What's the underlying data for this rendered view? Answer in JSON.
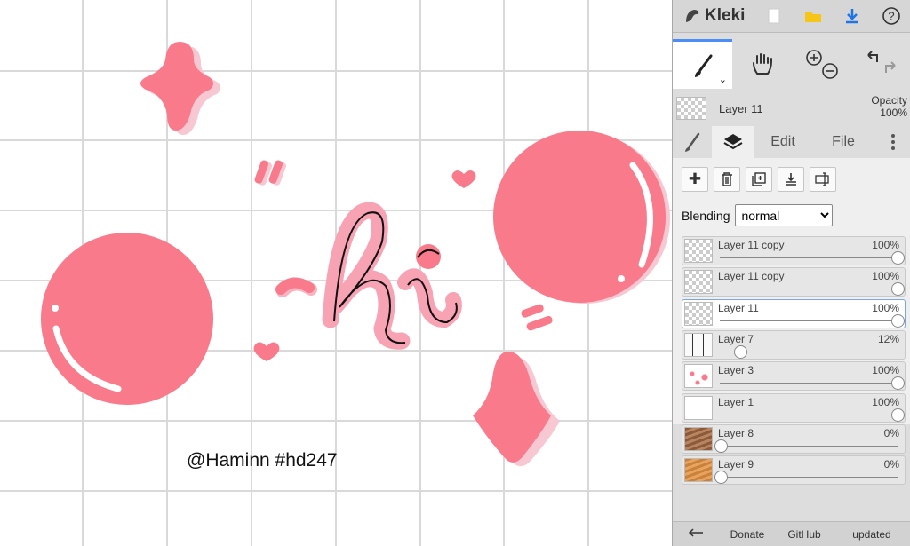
{
  "app": {
    "name": "Kleki"
  },
  "canvas": {
    "watermark": "@Haminn #hd247",
    "drawing_text": "hi"
  },
  "current_layer": {
    "name": "Layer 11",
    "opacity_label": "Opacity",
    "opacity_value": "100%"
  },
  "tabs": {
    "edit": "Edit",
    "file": "File"
  },
  "blending": {
    "label": "Blending",
    "value": "normal"
  },
  "layers": [
    {
      "name": "Layer 11 copy",
      "opacity": "100%",
      "level": 1.0,
      "selected": false
    },
    {
      "name": "Layer 11 copy",
      "opacity": "100%",
      "level": 1.0,
      "selected": false
    },
    {
      "name": "Layer 11",
      "opacity": "100%",
      "level": 1.0,
      "selected": true
    },
    {
      "name": "Layer 7",
      "opacity": "12%",
      "level": 0.12,
      "selected": false
    },
    {
      "name": "Layer 3",
      "opacity": "100%",
      "level": 1.0,
      "selected": false
    },
    {
      "name": "Layer 1",
      "opacity": "100%",
      "level": 1.0,
      "selected": false
    },
    {
      "name": "Layer 8",
      "opacity": "0%",
      "level": 0.0,
      "selected": false
    },
    {
      "name": "Layer 9",
      "opacity": "0%",
      "level": 0.0,
      "selected": false
    }
  ],
  "bottom": {
    "donate": "Donate",
    "github": "GitHub",
    "updated": "updated"
  },
  "colors": {
    "pink": "#f87a8b",
    "shadow_pink": "#f7c7d2",
    "accent": "#4b8df8"
  }
}
